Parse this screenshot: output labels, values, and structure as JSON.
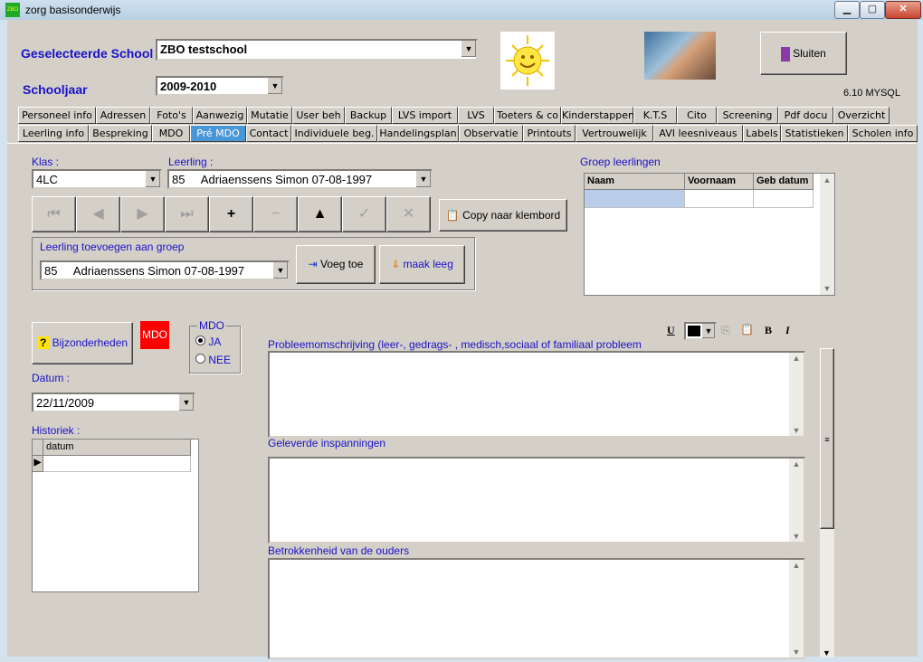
{
  "window": {
    "title": "zorg basisonderwijs",
    "app_icon_text": "ZBO",
    "minimize_icon": "minimize-icon",
    "maximize_icon": "maximize-icon",
    "close_icon": "close-icon"
  },
  "header": {
    "school_label": "Geselecteerde School :",
    "school_value": "ZBO testschool",
    "year_label": "Schooljaar",
    "year_value": "2009-2010",
    "close_button_label": "Sluiten",
    "version": "6.10 MYSQL"
  },
  "tabs_row1": [
    "Personeel info",
    "Adressen",
    "Foto's",
    "Aanwezig",
    "Mutatie",
    "User beh",
    "Backup",
    "LVS import",
    "LVS",
    "Toeters & co",
    "Kinderstappen",
    "K.T.S",
    "Cito",
    "Screening",
    "Pdf docu",
    "Overzicht"
  ],
  "tabs_row2": [
    "Leerling info",
    "Bespreking",
    "MDO",
    "Pré MDO",
    "Contact",
    "Individuele beg.",
    "Handelingsplan",
    "Observatie",
    "Printouts",
    "Vertrouwelijk",
    "AVI leesniveaus",
    "Labels",
    "Statistieken",
    "Scholen info"
  ],
  "active_tab": "Pré MDO",
  "klas": {
    "label": "Klas :",
    "value": "4LC"
  },
  "leerling": {
    "label": "Leerling :",
    "value": "85     Adriaenssens Simon 07-08-1997"
  },
  "nav_buttons": [
    "first",
    "prior",
    "next",
    "last",
    "insert",
    "delete",
    "edit",
    "post",
    "cancel"
  ],
  "copy_button_label": "Copy naar klembord",
  "groep_add": {
    "label": "Leerling toevoegen aan groep",
    "value": "85     Adriaenssens Simon 07-08-1997",
    "add_label": "Voeg toe",
    "clear_label": "maak leeg"
  },
  "groep_grid": {
    "title": "Groep leerlingen",
    "columns": [
      "Naam",
      "Voornaam",
      "Geb datum"
    ]
  },
  "bijzonderheden_label": "Bijzonderheden",
  "mdo_badge": "MDO",
  "mdo_group": {
    "title": "MDO",
    "options": [
      "JA",
      "NEE"
    ],
    "selected": "JA"
  },
  "datum": {
    "label": "Datum :",
    "value": "22/11/2009"
  },
  "historiek": {
    "label": "Historiek :",
    "column": "datum"
  },
  "format_toolbar": {
    "underline": "U",
    "bold": "B",
    "italic": "I",
    "color": "#000000"
  },
  "memos": [
    {
      "label": "Probleemomschrijving (leer-, gedrags- , medisch,sociaal of familiaal probleem",
      "text": ""
    },
    {
      "label": "Geleverde inspanningen",
      "text": ""
    },
    {
      "label": "Betrokkenheid van de ouders",
      "text": ""
    }
  ],
  "colors": {
    "active_tab": "#4a97d8",
    "label_blue": "#1a12c8",
    "mdo_badge": "#ff0000"
  }
}
